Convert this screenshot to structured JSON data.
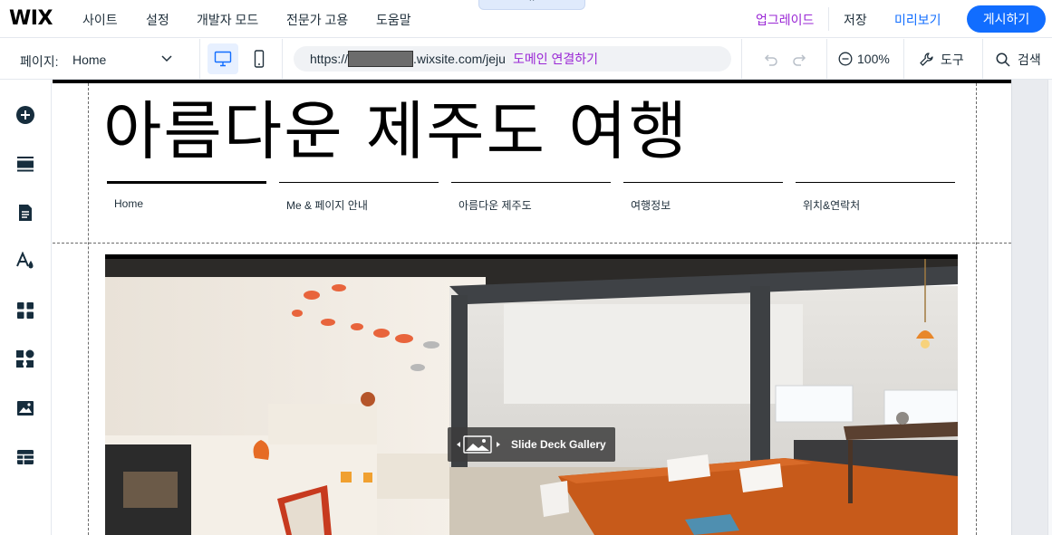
{
  "topbar": {
    "logo": "WIX",
    "menu": [
      "사이트",
      "설정",
      "개발자 모드",
      "전문가 고용",
      "도움말"
    ],
    "collapse_glyph": "⌃",
    "upgrade": "업그레이드",
    "save": "저장",
    "preview": "미리보기",
    "publish": "게시하기"
  },
  "toolbar": {
    "page_label": "페이지:",
    "page_value": "Home",
    "url_prefix": "https://",
    "url_suffix": ".wixsite.com/jeju",
    "domain_link": "도메인 연결하기",
    "zoom": "100%",
    "tools": "도구",
    "search": "검색"
  },
  "sidebar": {
    "items": [
      "add-icon",
      "sections-icon",
      "pages-icon",
      "design-icon",
      "apps-icon",
      "business-icon",
      "media-icon",
      "table-icon"
    ]
  },
  "site": {
    "title": "아름다운  제주도  여행",
    "nav": [
      "Home",
      "Me & 페이지 안내",
      "아름다운 제주도",
      "여행정보",
      "위치&연락처"
    ],
    "gallery_label": "Slide Deck Gallery"
  },
  "colors": {
    "accent": "#116dff",
    "upgrade": "#9a27d5",
    "text": "#20303c"
  }
}
